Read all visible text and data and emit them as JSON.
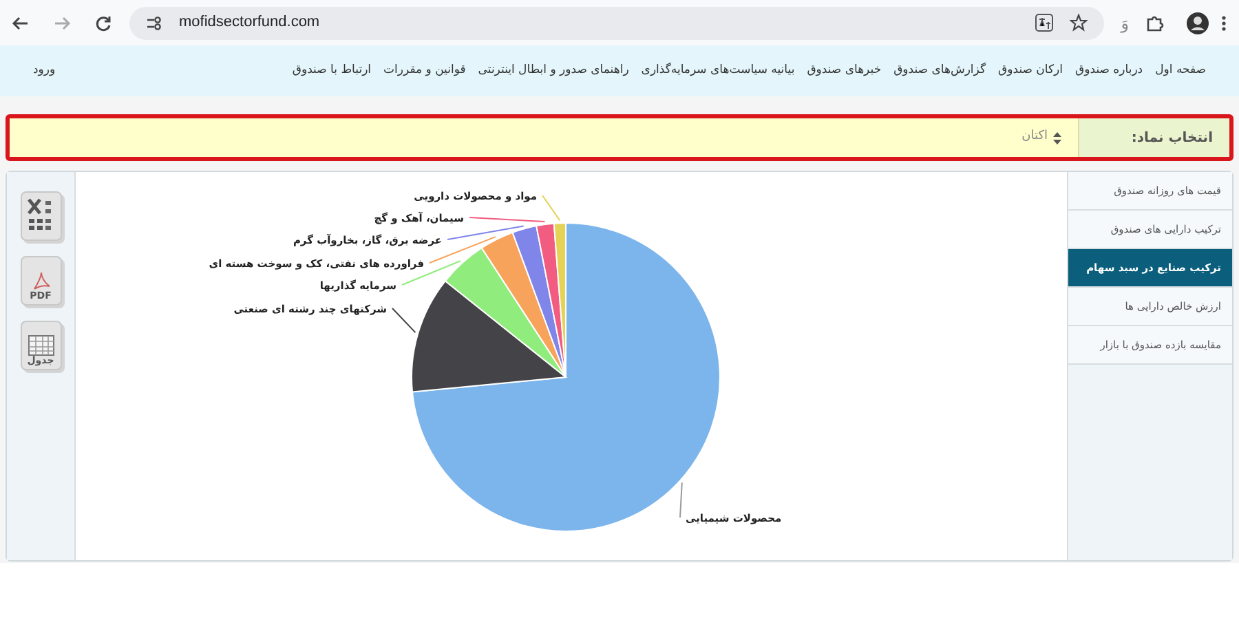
{
  "browser": {
    "url": "mofidsectorfund.com",
    "extension_glyph": "وَ"
  },
  "nav": {
    "items": [
      "صفحه اول",
      "درباره صندوق",
      "ارکان صندوق",
      "گزارش‌های صندوق",
      "خبرهای صندوق",
      "بیانیه سیاست‌های سرمایه‌گذاری",
      "راهنمای صدور و ابطال اینترنتی",
      "قوانین و مقررات",
      "ارتباط با صندوق"
    ],
    "login": "ورود"
  },
  "selector": {
    "label": "انتخاب نماد:",
    "value": "اکتان"
  },
  "sidebar": {
    "items": [
      {
        "label": "قیمت های روزانه صندوق",
        "selected": false
      },
      {
        "label": "ترکیب دارایی های صندوق",
        "selected": false
      },
      {
        "label": "ترکیب صنایع در سبد سهام",
        "selected": true
      },
      {
        "label": "ارزش خالص دارایی ها",
        "selected": false
      },
      {
        "label": "مقایسه بازده صندوق با بازار",
        "selected": false
      }
    ]
  },
  "export_buttons": [
    {
      "kind": "excel"
    },
    {
      "kind": "pdf",
      "label": "PDF"
    },
    {
      "kind": "table",
      "label": "جدول"
    }
  ],
  "chart_data": {
    "type": "pie",
    "categories": [
      "محصولات شیمیایی",
      "شرکتهای چند رشته ای صنعتی",
      "سرمایه گذاریها",
      "فراورده های نفتی، کک و سوخت هسته ای",
      "عرضه برق، گاز، بخاروآب گرم",
      "سیمان، آهک و گچ",
      "مواد و محصولات دارویی"
    ],
    "series": [
      {
        "color": [
          "#7cb5ec",
          "#434348",
          "#90ed7d",
          "#f7a35c",
          "#8085e9",
          "#f15c80",
          "#e4d354"
        ],
        "values": [
          72,
          12,
          5,
          3.5,
          2.5,
          1.8,
          1.2
        ]
      }
    ]
  }
}
